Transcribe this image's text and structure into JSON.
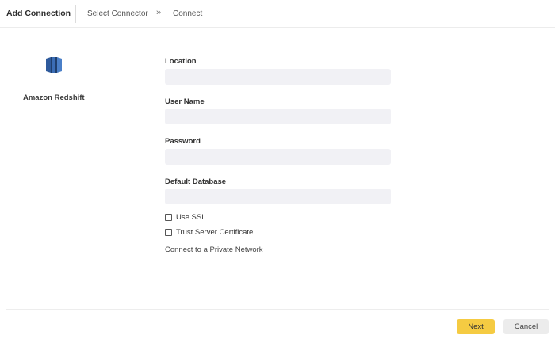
{
  "header": {
    "title": "Add Connection",
    "breadcrumb": [
      "Select Connector",
      "Connect"
    ],
    "separator": "»"
  },
  "connector": {
    "name": "Amazon Redshift",
    "icon": "amazon-redshift-icon",
    "icon_colors": [
      "#2e5a9c",
      "#4a7fc8",
      "#1f3f6e"
    ]
  },
  "form": {
    "location": {
      "label": "Location",
      "value": "",
      "placeholder": ""
    },
    "username": {
      "label": "User Name",
      "value": "",
      "placeholder": ""
    },
    "password": {
      "label": "Password",
      "value": "",
      "placeholder": ""
    },
    "default_database": {
      "label": "Default Database",
      "value": "",
      "placeholder": ""
    },
    "use_ssl": {
      "label": "Use SSL",
      "checked": false
    },
    "trust_cert": {
      "label": "Trust Server Certificate",
      "checked": false
    },
    "private_network_link": "Connect to a Private Network"
  },
  "footer": {
    "next_label": "Next",
    "cancel_label": "Cancel",
    "next_color": "#f5cb42"
  }
}
